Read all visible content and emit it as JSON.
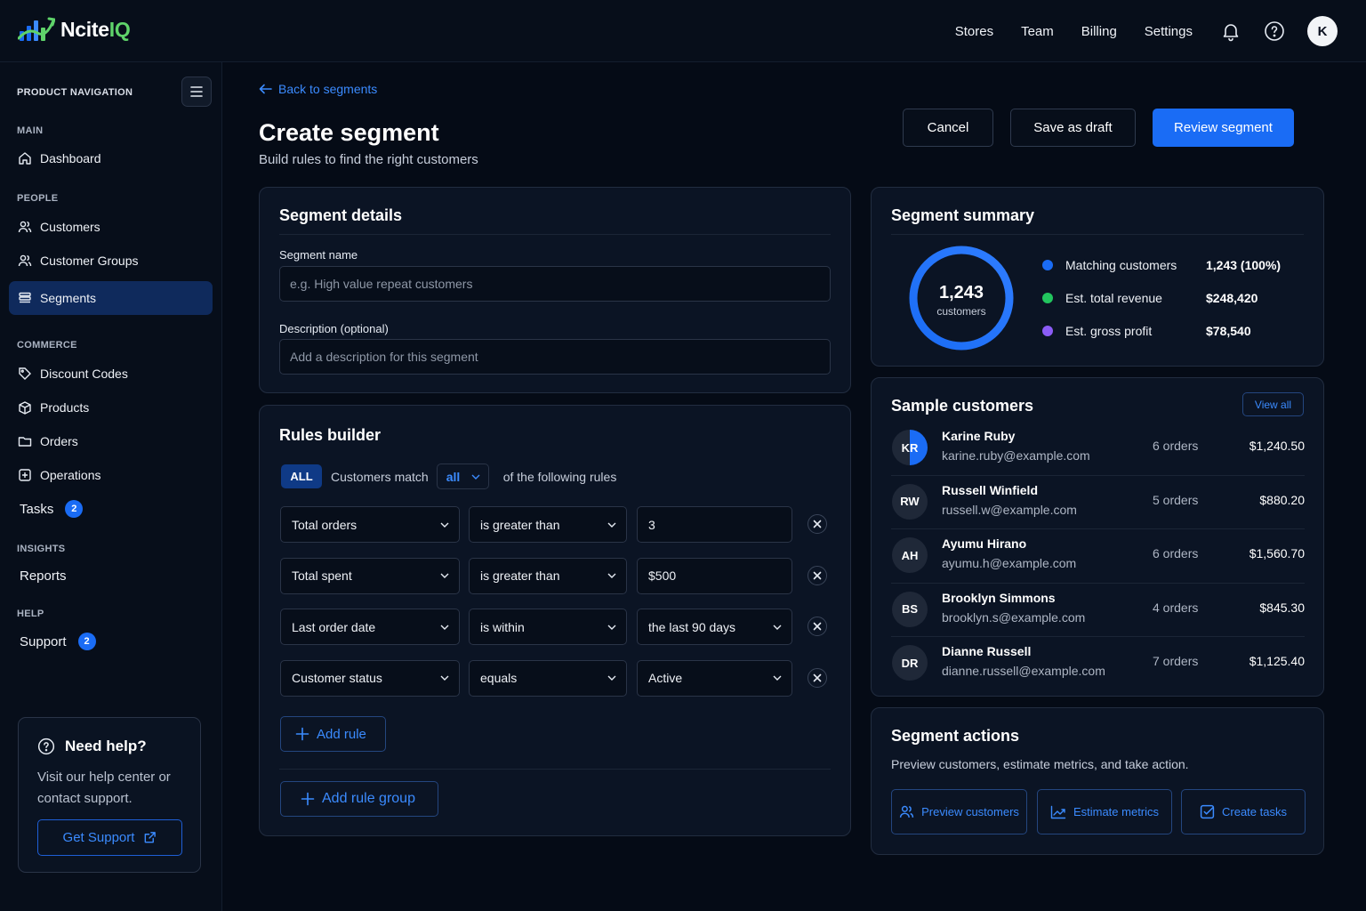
{
  "brand": {
    "name_main": "Ncite",
    "name_accent": "IQ"
  },
  "topnav": {
    "items": [
      "Stores",
      "Team",
      "Billing",
      "Settings"
    ],
    "avatar_initial": "K"
  },
  "sidebar": {
    "title": "PRODUCT NAVIGATION",
    "sections": {
      "main": "MAIN",
      "people": "PEOPLE",
      "commerce": "COMMERCE",
      "insights": "INSIGHTS",
      "help": "HELP"
    },
    "items": {
      "dashboard": "Dashboard",
      "customers": "Customers",
      "customer_groups": "Customer Groups",
      "segments": "Segments",
      "discount_codes": "Discount Codes",
      "products": "Products",
      "orders": "Orders",
      "operations": "Operations",
      "tasks": "Tasks",
      "tasks_badge": "2",
      "reports": "Reports",
      "support": "Support",
      "support_badge": "2"
    },
    "help_card": {
      "title": "Need help?",
      "text": "Visit our help center or contact support.",
      "button": "Get Support"
    }
  },
  "page": {
    "back_link": "Back to segments",
    "title": "Create segment",
    "subtitle": "Build rules to find the right customers",
    "buttons": {
      "cancel": "Cancel",
      "save_draft": "Save as draft",
      "review": "Review segment"
    }
  },
  "segment_details": {
    "title": "Segment details",
    "name_label": "Segment name",
    "name_placeholder": "e.g. High value repeat customers",
    "desc_label": "Description (optional)",
    "desc_placeholder": "Add a description for this segment"
  },
  "rules_builder": {
    "title": "Rules builder",
    "all_pill": "ALL",
    "match_prefix": "Customers match",
    "match_value": "all",
    "match_suffix": "of the following rules",
    "rules": [
      {
        "field": "Total orders",
        "operator": "is greater than",
        "value": "3",
        "value_is_select": false
      },
      {
        "field": "Total spent",
        "operator": "is greater than",
        "value": "$500",
        "value_is_select": false
      },
      {
        "field": "Last order date",
        "operator": "is within",
        "value": "the last 90 days",
        "value_is_select": true
      },
      {
        "field": "Customer status",
        "operator": "equals",
        "value": "Active",
        "value_is_select": true
      }
    ],
    "add_rule": "Add rule",
    "add_rule_group": "Add rule group"
  },
  "segment_summary": {
    "title": "Segment summary",
    "donut_value": "1,243",
    "donut_label": "customers",
    "donut_fraction": 1.0,
    "legend": [
      {
        "label": "Matching customers",
        "value": "1,243 (100%)",
        "color": "#1a6cf5"
      },
      {
        "label": "Est. total revenue",
        "value": "$248,420",
        "color": "#22c55e"
      },
      {
        "label": "Est. gross profit",
        "value": "$78,540",
        "color": "#8b5cf6"
      }
    ]
  },
  "sample_customers": {
    "title": "Sample customers",
    "view_all": "View all",
    "rows": [
      {
        "initials": "KR",
        "name": "Karine Ruby",
        "email": "karine.ruby@example.com",
        "orders": "6 orders",
        "amount": "$1,240.50"
      },
      {
        "initials": "RW",
        "name": "Russell Winfield",
        "email": "russell.w@example.com",
        "orders": "5 orders",
        "amount": "$880.20"
      },
      {
        "initials": "AH",
        "name": "Ayumu Hirano",
        "email": "ayumu.h@example.com",
        "orders": "6 orders",
        "amount": "$1,560.70"
      },
      {
        "initials": "BS",
        "name": "Brooklyn Simmons",
        "email": "brooklyn.s@example.com",
        "orders": "4 orders",
        "amount": "$845.30"
      },
      {
        "initials": "DR",
        "name": "Dianne Russell",
        "email": "dianne.russell@example.com",
        "orders": "7 orders",
        "amount": "$1,125.40"
      }
    ]
  },
  "segment_actions": {
    "title": "Segment actions",
    "description": "Preview customers, estimate metrics, and take action.",
    "buttons": {
      "preview": "Preview customers",
      "estimate": "Estimate metrics",
      "tasks": "Create tasks"
    }
  },
  "colors": {
    "accent": "#1a6cf5",
    "link": "#3b8bff",
    "brand_green": "#5fd36a",
    "background": "#050b16"
  }
}
